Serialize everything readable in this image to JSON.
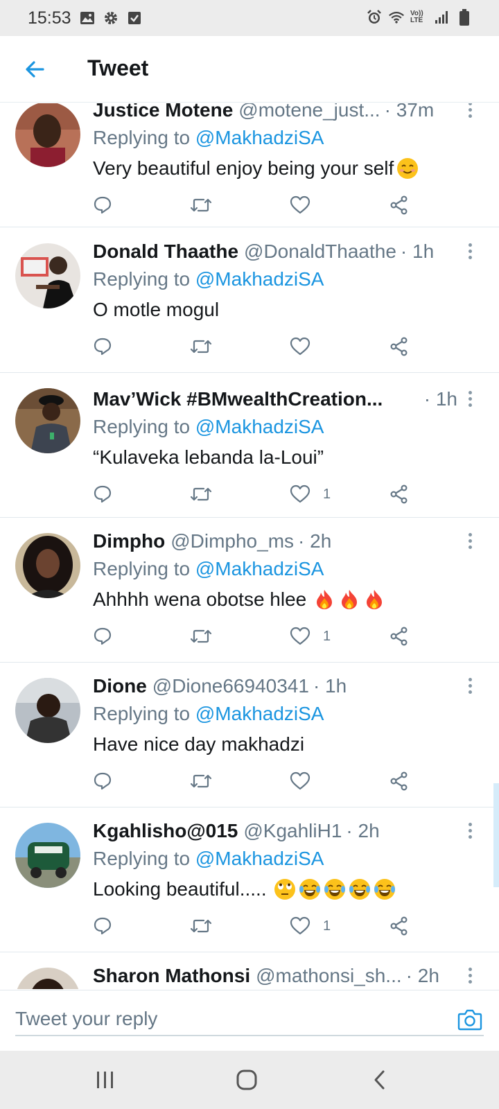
{
  "status_bar": {
    "time": "15:53",
    "left_icons": [
      "image-icon",
      "gear-icon",
      "checkbox-icon"
    ],
    "right_icons": [
      "alarm-icon",
      "wifi-icon",
      "volte-icon",
      "signal-icon",
      "battery-icon"
    ],
    "volte_label": "Vo)) LTE"
  },
  "header": {
    "title": "Tweet",
    "back_icon": "arrow-left-icon"
  },
  "colors": {
    "accent": "#1b95e0",
    "text_primary": "#14171a",
    "text_secondary": "#657786",
    "divider": "#e1e8ed"
  },
  "tweets": [
    {
      "name": "Justice Motene",
      "handle": "@motene_just...",
      "time": "· 37m",
      "replying_prefix": "Replying to",
      "replying_to": "@MakhadziSA",
      "text": "Very beautiful enjoy being your self",
      "emojis": [
        "smiling-face"
      ],
      "likes": ""
    },
    {
      "name": "Donald Thaathe",
      "handle": "@DonaldThaathe",
      "time": "· 1h",
      "replying_prefix": "Replying to",
      "replying_to": "@MakhadziSA",
      "text": "O motle mogul",
      "emojis": [],
      "likes": ""
    },
    {
      "name": "Mav’Wick #BMwealthCreation...",
      "handle": "",
      "time": "· 1h",
      "replying_prefix": "Replying to",
      "replying_to": "@MakhadziSA",
      "text": "“Kulaveka lebanda la-Loui”",
      "emojis": [],
      "likes": "1"
    },
    {
      "name": "Dimpho",
      "handle": "@Dimpho_ms",
      "time": "· 2h",
      "replying_prefix": "Replying to",
      "replying_to": "@MakhadziSA",
      "text": "Ahhhh wena obotse hlee",
      "emojis": [
        "fire",
        "fire",
        "fire"
      ],
      "likes": "1"
    },
    {
      "name": "Dione",
      "handle": "@Dione66940341",
      "time": "· 1h",
      "replying_prefix": "Replying to",
      "replying_to": "@MakhadziSA",
      "text": "Have nice day makhadzi",
      "emojis": [],
      "likes": ""
    },
    {
      "name": "Kgahlisho@015",
      "handle": "@KgahliH1",
      "time": "· 2h",
      "replying_prefix": "Replying to",
      "replying_to": "@MakhadziSA",
      "text": "Looking beautiful.....",
      "emojis": [
        "rolling-eyes",
        "tears-of-joy",
        "tears-of-joy",
        "tears-of-joy",
        "tears-of-joy"
      ],
      "likes": "1"
    },
    {
      "name": "Sharon Mathonsi",
      "handle": "@mathonsi_sh...",
      "time": "· 2h",
      "replying_prefix": "",
      "replying_to": "",
      "text": "",
      "emojis": [],
      "likes": ""
    }
  ],
  "reply_bar": {
    "placeholder": "Tweet your reply",
    "camera_icon": "camera-icon"
  },
  "nav_bar": {
    "icons": [
      "recent-apps-icon",
      "home-icon",
      "back-icon"
    ]
  }
}
